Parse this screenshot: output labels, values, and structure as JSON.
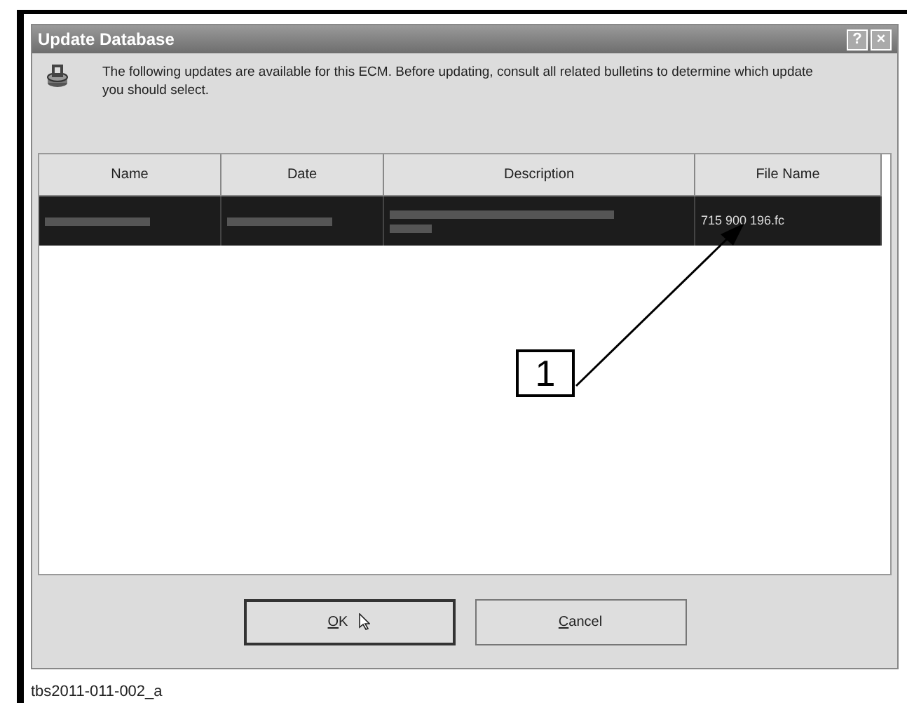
{
  "window": {
    "title": "Update Database",
    "title_buttons": [
      "?",
      "×"
    ]
  },
  "message": "The following updates are available for this ECM. Before updating, consult all related bulletins to determine which update you should select.",
  "table": {
    "columns": [
      "Name",
      "Date",
      "Description",
      "File Name"
    ],
    "rows": [
      {
        "selected": true,
        "cells": [
          {
            "kind": "redacted"
          },
          {
            "kind": "redacted"
          },
          {
            "kind": "redacted"
          },
          {
            "kind": "text",
            "text": "715 900 196.fc"
          }
        ]
      }
    ]
  },
  "callout": {
    "label": "1"
  },
  "buttons": [
    {
      "label": "OK",
      "default": true
    },
    {
      "label": "Cancel",
      "default": false
    }
  ],
  "caption": "tbs2011-011-002_a"
}
